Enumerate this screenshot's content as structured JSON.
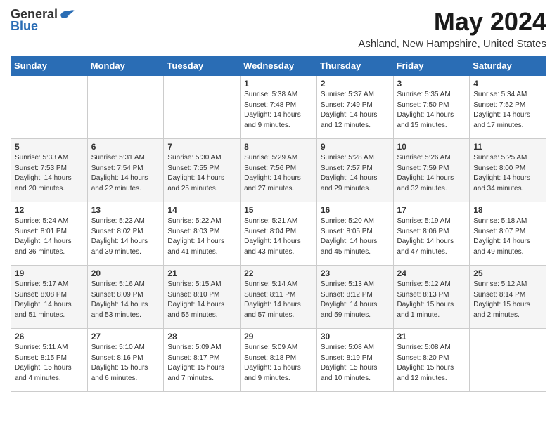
{
  "header": {
    "logo_general": "General",
    "logo_blue": "Blue",
    "month": "May 2024",
    "location": "Ashland, New Hampshire, United States"
  },
  "days_of_week": [
    "Sunday",
    "Monday",
    "Tuesday",
    "Wednesday",
    "Thursday",
    "Friday",
    "Saturday"
  ],
  "weeks": [
    [
      {
        "day": "",
        "sunrise": "",
        "sunset": "",
        "daylight": ""
      },
      {
        "day": "",
        "sunrise": "",
        "sunset": "",
        "daylight": ""
      },
      {
        "day": "",
        "sunrise": "",
        "sunset": "",
        "daylight": ""
      },
      {
        "day": "1",
        "sunrise": "Sunrise: 5:38 AM",
        "sunset": "Sunset: 7:48 PM",
        "daylight": "Daylight: 14 hours and 9 minutes."
      },
      {
        "day": "2",
        "sunrise": "Sunrise: 5:37 AM",
        "sunset": "Sunset: 7:49 PM",
        "daylight": "Daylight: 14 hours and 12 minutes."
      },
      {
        "day": "3",
        "sunrise": "Sunrise: 5:35 AM",
        "sunset": "Sunset: 7:50 PM",
        "daylight": "Daylight: 14 hours and 15 minutes."
      },
      {
        "day": "4",
        "sunrise": "Sunrise: 5:34 AM",
        "sunset": "Sunset: 7:52 PM",
        "daylight": "Daylight: 14 hours and 17 minutes."
      }
    ],
    [
      {
        "day": "5",
        "sunrise": "Sunrise: 5:33 AM",
        "sunset": "Sunset: 7:53 PM",
        "daylight": "Daylight: 14 hours and 20 minutes."
      },
      {
        "day": "6",
        "sunrise": "Sunrise: 5:31 AM",
        "sunset": "Sunset: 7:54 PM",
        "daylight": "Daylight: 14 hours and 22 minutes."
      },
      {
        "day": "7",
        "sunrise": "Sunrise: 5:30 AM",
        "sunset": "Sunset: 7:55 PM",
        "daylight": "Daylight: 14 hours and 25 minutes."
      },
      {
        "day": "8",
        "sunrise": "Sunrise: 5:29 AM",
        "sunset": "Sunset: 7:56 PM",
        "daylight": "Daylight: 14 hours and 27 minutes."
      },
      {
        "day": "9",
        "sunrise": "Sunrise: 5:28 AM",
        "sunset": "Sunset: 7:57 PM",
        "daylight": "Daylight: 14 hours and 29 minutes."
      },
      {
        "day": "10",
        "sunrise": "Sunrise: 5:26 AM",
        "sunset": "Sunset: 7:59 PM",
        "daylight": "Daylight: 14 hours and 32 minutes."
      },
      {
        "day": "11",
        "sunrise": "Sunrise: 5:25 AM",
        "sunset": "Sunset: 8:00 PM",
        "daylight": "Daylight: 14 hours and 34 minutes."
      }
    ],
    [
      {
        "day": "12",
        "sunrise": "Sunrise: 5:24 AM",
        "sunset": "Sunset: 8:01 PM",
        "daylight": "Daylight: 14 hours and 36 minutes."
      },
      {
        "day": "13",
        "sunrise": "Sunrise: 5:23 AM",
        "sunset": "Sunset: 8:02 PM",
        "daylight": "Daylight: 14 hours and 39 minutes."
      },
      {
        "day": "14",
        "sunrise": "Sunrise: 5:22 AM",
        "sunset": "Sunset: 8:03 PM",
        "daylight": "Daylight: 14 hours and 41 minutes."
      },
      {
        "day": "15",
        "sunrise": "Sunrise: 5:21 AM",
        "sunset": "Sunset: 8:04 PM",
        "daylight": "Daylight: 14 hours and 43 minutes."
      },
      {
        "day": "16",
        "sunrise": "Sunrise: 5:20 AM",
        "sunset": "Sunset: 8:05 PM",
        "daylight": "Daylight: 14 hours and 45 minutes."
      },
      {
        "day": "17",
        "sunrise": "Sunrise: 5:19 AM",
        "sunset": "Sunset: 8:06 PM",
        "daylight": "Daylight: 14 hours and 47 minutes."
      },
      {
        "day": "18",
        "sunrise": "Sunrise: 5:18 AM",
        "sunset": "Sunset: 8:07 PM",
        "daylight": "Daylight: 14 hours and 49 minutes."
      }
    ],
    [
      {
        "day": "19",
        "sunrise": "Sunrise: 5:17 AM",
        "sunset": "Sunset: 8:08 PM",
        "daylight": "Daylight: 14 hours and 51 minutes."
      },
      {
        "day": "20",
        "sunrise": "Sunrise: 5:16 AM",
        "sunset": "Sunset: 8:09 PM",
        "daylight": "Daylight: 14 hours and 53 minutes."
      },
      {
        "day": "21",
        "sunrise": "Sunrise: 5:15 AM",
        "sunset": "Sunset: 8:10 PM",
        "daylight": "Daylight: 14 hours and 55 minutes."
      },
      {
        "day": "22",
        "sunrise": "Sunrise: 5:14 AM",
        "sunset": "Sunset: 8:11 PM",
        "daylight": "Daylight: 14 hours and 57 minutes."
      },
      {
        "day": "23",
        "sunrise": "Sunrise: 5:13 AM",
        "sunset": "Sunset: 8:12 PM",
        "daylight": "Daylight: 14 hours and 59 minutes."
      },
      {
        "day": "24",
        "sunrise": "Sunrise: 5:12 AM",
        "sunset": "Sunset: 8:13 PM",
        "daylight": "Daylight: 15 hours and 1 minute."
      },
      {
        "day": "25",
        "sunrise": "Sunrise: 5:12 AM",
        "sunset": "Sunset: 8:14 PM",
        "daylight": "Daylight: 15 hours and 2 minutes."
      }
    ],
    [
      {
        "day": "26",
        "sunrise": "Sunrise: 5:11 AM",
        "sunset": "Sunset: 8:15 PM",
        "daylight": "Daylight: 15 hours and 4 minutes."
      },
      {
        "day": "27",
        "sunrise": "Sunrise: 5:10 AM",
        "sunset": "Sunset: 8:16 PM",
        "daylight": "Daylight: 15 hours and 6 minutes."
      },
      {
        "day": "28",
        "sunrise": "Sunrise: 5:09 AM",
        "sunset": "Sunset: 8:17 PM",
        "daylight": "Daylight: 15 hours and 7 minutes."
      },
      {
        "day": "29",
        "sunrise": "Sunrise: 5:09 AM",
        "sunset": "Sunset: 8:18 PM",
        "daylight": "Daylight: 15 hours and 9 minutes."
      },
      {
        "day": "30",
        "sunrise": "Sunrise: 5:08 AM",
        "sunset": "Sunset: 8:19 PM",
        "daylight": "Daylight: 15 hours and 10 minutes."
      },
      {
        "day": "31",
        "sunrise": "Sunrise: 5:08 AM",
        "sunset": "Sunset: 8:20 PM",
        "daylight": "Daylight: 15 hours and 12 minutes."
      },
      {
        "day": "",
        "sunrise": "",
        "sunset": "",
        "daylight": ""
      }
    ]
  ]
}
